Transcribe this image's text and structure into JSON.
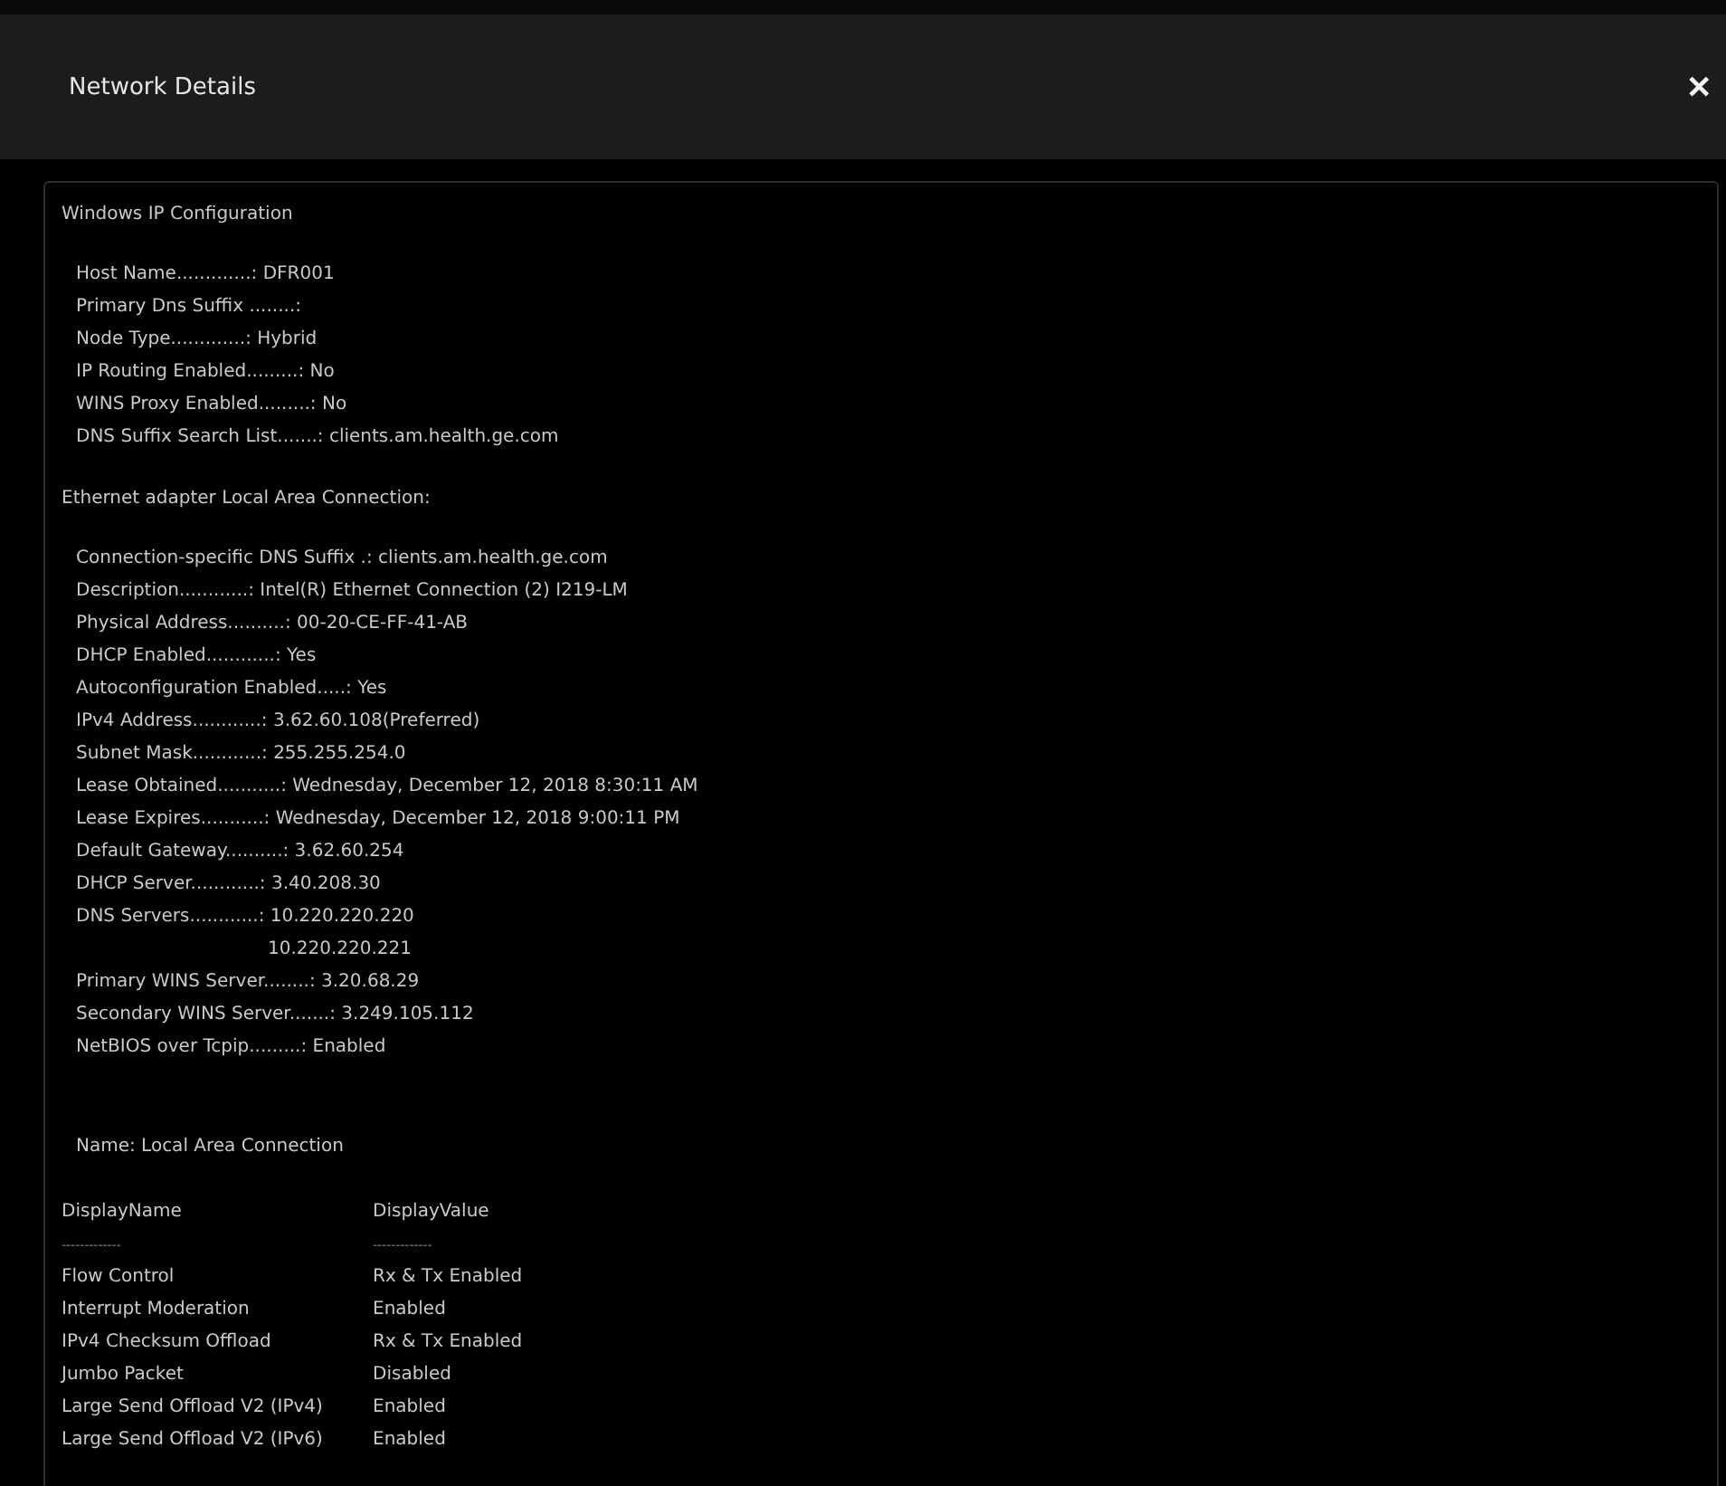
{
  "dialog": {
    "title": "Network Details",
    "close": "✕"
  },
  "sections": [
    {
      "heading": "Windows IP Configuration",
      "entries": [
        {
          "kind": "field",
          "text": "Host Name.............: DFR001"
        },
        {
          "kind": "field",
          "text": "Primary Dns Suffix ........:"
        },
        {
          "kind": "field",
          "text": "Node Type.............: Hybrid"
        },
        {
          "kind": "field",
          "text": "IP Routing Enabled.........: No"
        },
        {
          "kind": "field",
          "text": "WINS Proxy Enabled.........: No"
        },
        {
          "kind": "field",
          "text": "DNS Suffix Search List.......: clients.am.health.ge.com"
        }
      ]
    },
    {
      "heading": "Ethernet adapter Local Area Connection:",
      "entries": [
        {
          "kind": "field",
          "text": "Connection-specific DNS Suffix .: clients.am.health.ge.com"
        },
        {
          "kind": "field",
          "text": "Description............: Intel(R) Ethernet Connection (2) I219-LM"
        },
        {
          "kind": "field",
          "text": "Physical Address..........: 00-20-CE-FF-41-AB"
        },
        {
          "kind": "field",
          "text": "DHCP Enabled............: Yes"
        },
        {
          "kind": "field",
          "text": "Autoconfiguration Enabled.....: Yes"
        },
        {
          "kind": "field",
          "text": "IPv4 Address............: 3.62.60.108(Preferred)"
        },
        {
          "kind": "field",
          "text": "Subnet Mask............: 255.255.254.0"
        },
        {
          "kind": "field",
          "text": "Lease Obtained...........: Wednesday, December 12, 2018 8:30:11 AM"
        },
        {
          "kind": "field",
          "text": "Lease Expires...........: Wednesday, December 12, 2018 9:00:11 PM"
        },
        {
          "kind": "field",
          "text": "Default Gateway..........: 3.62.60.254"
        },
        {
          "kind": "field",
          "text": "DHCP Server............: 3.40.208.30"
        },
        {
          "kind": "field",
          "text": "DNS Servers............: 10.220.220.220"
        },
        {
          "kind": "continuation",
          "text": "10.220.220.221"
        },
        {
          "kind": "field",
          "text": "Primary WINS Server........: 3.20.68.29"
        },
        {
          "kind": "field",
          "text": "Secondary WINS Server.......: 3.249.105.112"
        },
        {
          "kind": "field",
          "text": "NetBIOS over Tcpip.........: Enabled"
        }
      ]
    }
  ],
  "adapter_name": "Name: Local Area Connection",
  "properties": {
    "columns": [
      "DisplayName",
      "DisplayValue"
    ],
    "underlines": [
      "-------------",
      "-------------"
    ],
    "rows": [
      {
        "name": "Flow Control",
        "value": "Rx & Tx Enabled"
      },
      {
        "name": "Interrupt Moderation",
        "value": "Enabled"
      },
      {
        "name": "IPv4 Checksum Offload",
        "value": "Rx & Tx Enabled"
      },
      {
        "name": "Jumbo Packet",
        "value": "Disabled"
      },
      {
        "name": "Large Send Offload V2 (IPv4)",
        "value": "Enabled"
      },
      {
        "name": "Large Send Offload V2 (IPv6)",
        "value": "Enabled"
      }
    ]
  }
}
